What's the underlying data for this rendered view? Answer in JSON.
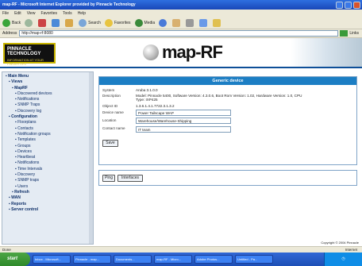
{
  "window": {
    "title": "map-RF - Microsoft Internet Explorer provided by Pinnacle Technology",
    "menu": [
      "File",
      "Edit",
      "View",
      "Favorites",
      "Tools",
      "Help"
    ]
  },
  "toolbar": {
    "back": "Back",
    "search": "Search",
    "favorites": "Favorites",
    "media": "Media"
  },
  "address": {
    "label": "Address",
    "value": "http://map-rf:8080",
    "go": "Go",
    "links": "Links"
  },
  "banner": {
    "left_logo_line1": "PINNACLE TECHNOLOGY",
    "left_logo_line2": "INFORMATION AT YOUR FINGERTIPS",
    "product": "map-RF"
  },
  "sidebar": {
    "items": [
      {
        "label": "Main Menu",
        "level": 0
      },
      {
        "label": "Views",
        "level": 1
      },
      {
        "label": "MapRF",
        "level": 2
      },
      {
        "label": "Discovered devices",
        "level": 3
      },
      {
        "label": "Notifications",
        "level": 3
      },
      {
        "label": "SNMP Traps",
        "level": 3
      },
      {
        "label": "Discovery log",
        "level": 3
      },
      {
        "label": "Configuration",
        "level": 1
      },
      {
        "label": "Floorplans",
        "level": 3
      },
      {
        "label": "Contacts",
        "level": 3
      },
      {
        "label": "Notification groups",
        "level": 3
      },
      {
        "label": "Templates",
        "level": 3
      },
      {
        "label": "Groups",
        "level": 3
      },
      {
        "label": "Devices",
        "level": 3
      },
      {
        "label": "Heartbeat",
        "level": 3
      },
      {
        "label": "Notifications",
        "level": 3
      },
      {
        "label": "Time Intervals",
        "level": 3
      },
      {
        "label": "Discovery",
        "level": 3
      },
      {
        "label": "SNMP traps",
        "level": 3
      },
      {
        "label": "Users",
        "level": 3
      },
      {
        "label": "Refresh",
        "level": 2
      },
      {
        "label": "WAN",
        "level": 1
      },
      {
        "label": "Reports",
        "level": 1
      },
      {
        "label": "Server control",
        "level": 1
      }
    ]
  },
  "panel": {
    "header": "Generic device",
    "system_label": "System",
    "system_value": "Aruba 3.1.0.0",
    "description_label": "Description",
    "description_value": "Model: Pinnacle 5400, Software Version: 4.3.0.6, Boot Rom Version: 1.02, Hardware Version: 1.0, CPU Type: IXP425",
    "object_id_label": "Object ID",
    "object_id_value": "1.3.6.1.4.1.7722.3.1.3.2",
    "device_name_label": "Device name",
    "device_name_value": "Power Tailscape WAP",
    "location_label": "Location",
    "location_value": "Warehouse/Warehouse-Shipping",
    "contact_label": "Contact name",
    "contact_value": "IT team",
    "save_button": "Save"
  },
  "actions": {
    "ping_button": "Ping",
    "interfaces_button": "Interfaces"
  },
  "footer": {
    "copyright": "Copyright © 2004 Pinnacle"
  },
  "status": {
    "text": "Done",
    "zone": "Internet"
  },
  "taskbar": {
    "start": "start",
    "tasks": [
      "Inbox - Microsoft...",
      "Pinnacle - map...",
      "Documents...",
      "map-RF - Micro...",
      "Adobe Photos...",
      "Untitled - Pa..."
    ]
  }
}
